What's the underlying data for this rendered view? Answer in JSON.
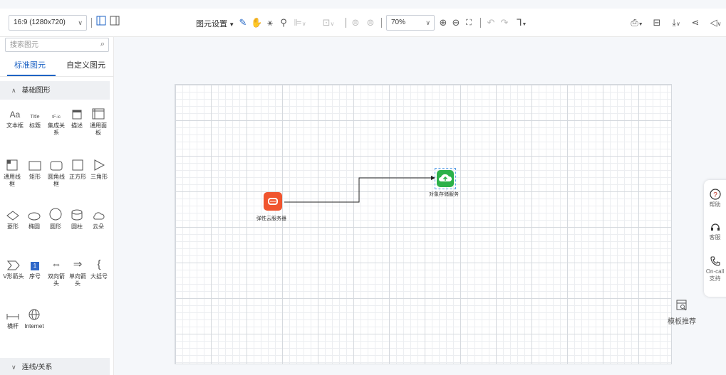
{
  "toolbar": {
    "page_size": "16:9 (1280x720)",
    "element_settings": "图元设置",
    "zoom": "70%"
  },
  "left_panel": {
    "search_placeholder": "搜索图元",
    "tabs": [
      "标准图元",
      "自定义图元"
    ],
    "sections": {
      "basic": "基础图形",
      "connector": "连线/关系"
    },
    "shapes": [
      {
        "icon": "text-box-icon",
        "glyph": "Aa",
        "label": "文本框"
      },
      {
        "icon": "title-icon",
        "glyph": "Title",
        "label": "标题"
      },
      {
        "icon": "integration-icon",
        "glyph": "tF-ic",
        "label": "集成关系"
      },
      {
        "icon": "description-icon",
        "glyph": "",
        "label": "描述"
      },
      {
        "icon": "panel-icon",
        "glyph": "",
        "label": "通用面板"
      },
      {
        "icon": "frame-icon",
        "glyph": "",
        "label": "通用线框"
      },
      {
        "icon": "rectangle-icon",
        "glyph": "",
        "label": "矩形"
      },
      {
        "icon": "rounded-frame-icon",
        "glyph": "",
        "label": "圆角线框"
      },
      {
        "icon": "square-icon",
        "glyph": "",
        "label": "正方形"
      },
      {
        "icon": "triangle-icon",
        "glyph": "",
        "label": "三角形"
      },
      {
        "icon": "diamond-icon",
        "glyph": "",
        "label": "菱形"
      },
      {
        "icon": "ellipse-icon",
        "glyph": "",
        "label": "椭圆"
      },
      {
        "icon": "circle-icon",
        "glyph": "",
        "label": "圆形"
      },
      {
        "icon": "cylinder-icon",
        "glyph": "",
        "label": "圆柱"
      },
      {
        "icon": "cloud-icon",
        "glyph": "",
        "label": "云朵"
      },
      {
        "icon": "chevron-arrow-icon",
        "glyph": "",
        "label": "V形箭头"
      },
      {
        "icon": "sequence-number-icon",
        "glyph": "1",
        "label": "序号"
      },
      {
        "icon": "double-arrow-icon",
        "glyph": "⇔",
        "label": "双向箭头"
      },
      {
        "icon": "single-arrow-icon",
        "glyph": "⇒",
        "label": "单向箭头"
      },
      {
        "icon": "brace-icon",
        "glyph": "{",
        "label": "大括号"
      },
      {
        "icon": "beam-icon",
        "glyph": "",
        "label": "横杆"
      },
      {
        "icon": "internet-icon",
        "glyph": "",
        "label": "Internet"
      }
    ]
  },
  "canvas": {
    "nodes": [
      {
        "label": "弹性云服务器",
        "color": "#f0552f",
        "icon": "ecs-icon"
      },
      {
        "label": "对象存储服务",
        "color": "#2cb14a",
        "icon": "obs-cloud-upload-icon"
      }
    ]
  },
  "float_bar": {
    "items": [
      {
        "icon": "help-icon",
        "label": "帮助"
      },
      {
        "icon": "customer-service-icon",
        "label": "客服"
      },
      {
        "icon": "oncall-icon",
        "label": "On-call 支持"
      }
    ]
  },
  "template_recommend": "模板推荐"
}
